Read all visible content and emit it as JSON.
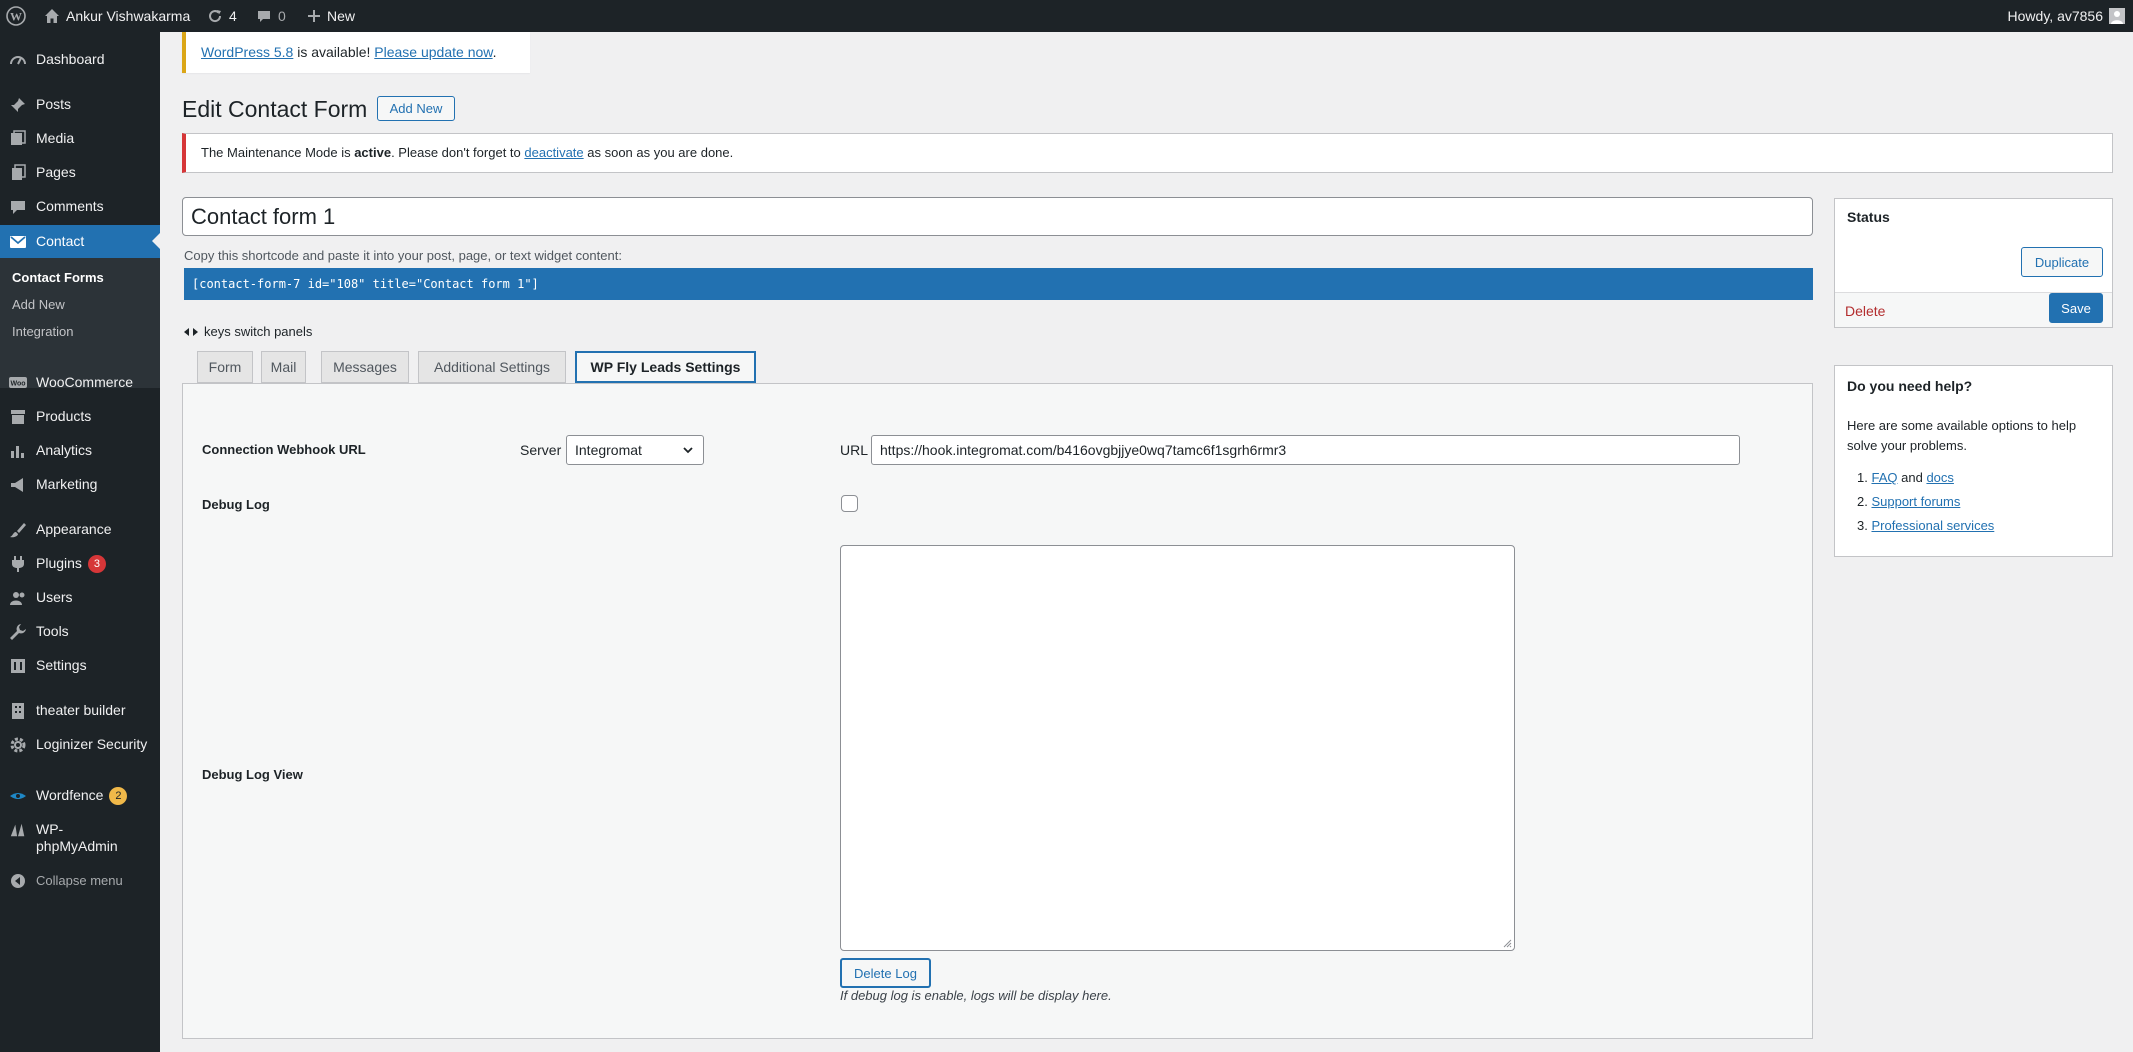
{
  "adminbar": {
    "site_name": "Ankur Vishwakarma",
    "updates_count": "4",
    "comments_count": "0",
    "new_label": "New",
    "howdy": "Howdy, av7856"
  },
  "sidebar": {
    "dashboard": "Dashboard",
    "posts": "Posts",
    "media": "Media",
    "pages": "Pages",
    "comments": "Comments",
    "contact": "Contact",
    "sub_contact_forms": "Contact Forms",
    "sub_add_new": "Add New",
    "sub_integration": "Integration",
    "woocommerce": "WooCommerce",
    "products": "Products",
    "analytics": "Analytics",
    "marketing": "Marketing",
    "appearance": "Appearance",
    "plugins": "Plugins",
    "plugins_badge": "3",
    "users": "Users",
    "tools": "Tools",
    "settings": "Settings",
    "theater_builder": "theater builder",
    "loginizer": "Loginizer Security",
    "wordfence": "Wordfence",
    "wordfence_badge": "2",
    "phpmyadmin": "WP-phpMyAdmin",
    "collapse": "Collapse menu"
  },
  "notices": {
    "update_version": "WordPress 5.8",
    "update_mid": " is available! ",
    "update_link": "Please update now",
    "update_end": ".",
    "maint_pre": "The Maintenance Mode is ",
    "maint_bold": "active",
    "maint_mid": ". Please don't forget to ",
    "maint_link": "deactivate",
    "maint_end": " as soon as you are done."
  },
  "page": {
    "title": "Edit Contact Form",
    "add_new": "Add New",
    "form_title": "Contact form 1",
    "shortcode_hint": "Copy this shortcode and paste it into your post, page, or text widget content:",
    "shortcode": "[contact-form-7 id=\"108\" title=\"Contact form 1\"]",
    "keys_hint": "keys switch panels"
  },
  "tabs": {
    "form": "Form",
    "mail": "Mail",
    "messages": "Messages",
    "additional": "Additional Settings",
    "flyleads": "WP Fly Leads Settings"
  },
  "flyleads": {
    "webhook_label": "Connection Webhook URL",
    "server_label": "Server",
    "server_value": "Integromat",
    "url_label": "URL",
    "url_value": "https://hook.integromat.com/b416ovgbjjye0wq7tamc6f1sgrh6rmr3",
    "debug_log_label": "Debug Log",
    "debug_log_checked": false,
    "debug_view_label": "Debug Log View",
    "log_content": "",
    "delete_log": "Delete Log",
    "help_text": "If debug log is enable, logs will be display here."
  },
  "status_box": {
    "title": "Status",
    "duplicate": "Duplicate",
    "delete": "Delete",
    "save": "Save"
  },
  "help_box": {
    "title": "Do you need help?",
    "intro": "Here are some available options to help solve your problems.",
    "item1_a": "FAQ",
    "item1_and": "and",
    "item1_b": "docs",
    "item2": "Support forums",
    "item3": "Professional services"
  },
  "colors": {
    "accent": "#2271b1",
    "adminbar": "#1d2327",
    "warning": "#dba617",
    "error": "#d63638",
    "badge_red": "#d63638",
    "badge_orange": "#f0b849"
  }
}
